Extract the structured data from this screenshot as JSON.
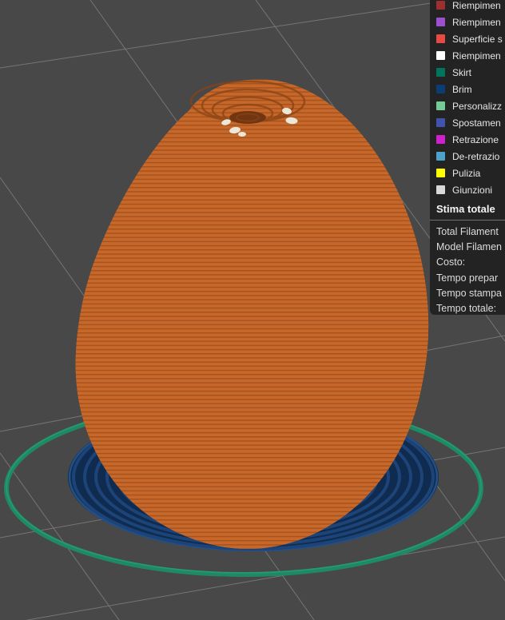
{
  "legend": {
    "items": [
      {
        "label": "Riempimen",
        "color": "#9e2f2f"
      },
      {
        "label": "Riempimen",
        "color": "#9c50d0"
      },
      {
        "label": "Superficie s",
        "color": "#e64a45"
      },
      {
        "label": "Riempimen",
        "color": "#ffffff"
      },
      {
        "label": "Skirt",
        "color": "#00755e"
      },
      {
        "label": "Brim",
        "color": "#0a3d74"
      },
      {
        "label": "Personalizz",
        "color": "#74cb96"
      },
      {
        "label": "Spostamen",
        "color": "#4053ae"
      },
      {
        "label": "Retrazione",
        "color": "#cc21cc"
      },
      {
        "label": "De-retrazio",
        "color": "#4da2cc"
      },
      {
        "label": "Pulizia",
        "color": "#ffff00"
      },
      {
        "label": "Giunzioni",
        "color": "#d9d9d9"
      }
    ]
  },
  "totals": {
    "title": "Stima totale",
    "rows": [
      "Total Filament",
      "Model Filamen",
      "Costo:",
      "Tempo prepar",
      "Tempo stampa",
      "Tempo totale:"
    ]
  },
  "scene": {
    "plate_color": "#484848",
    "grid_color": "#9a9a9a",
    "model_color": "#c7682a",
    "model_layer_shadow": "#9c4e1d",
    "model_inner_color": "#713611",
    "crater_ring_color": "#8a4315",
    "seam_blob_color": "#ece7d9",
    "brim_fill_color": "#0f2c50",
    "brim_ring_color": "#1d4478",
    "brim_edge_color": "#245088",
    "skirt_color": "#1e8a64",
    "panel_color": "#212121"
  }
}
